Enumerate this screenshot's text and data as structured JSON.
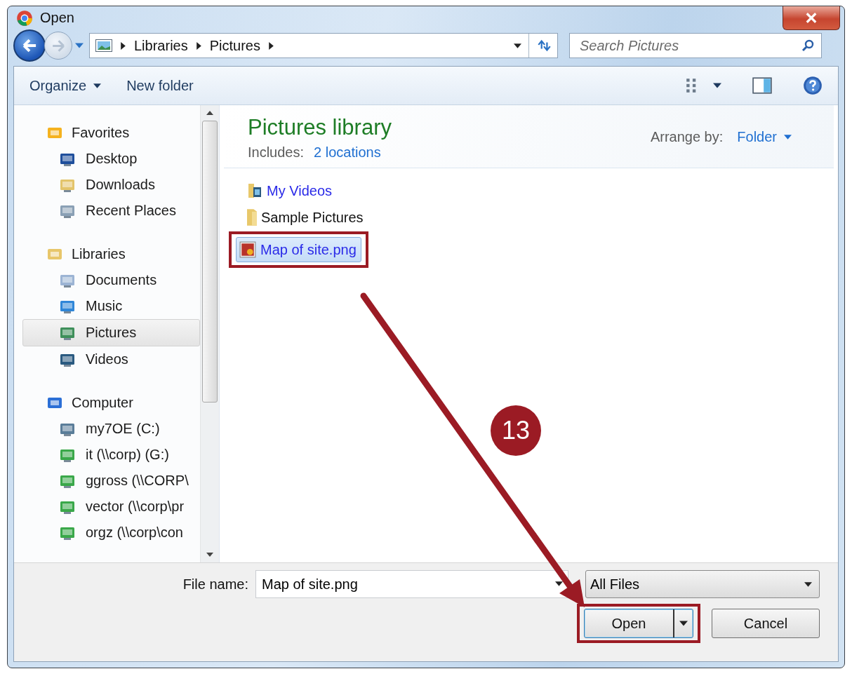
{
  "window": {
    "title": "Open"
  },
  "address": {
    "crumbs": [
      "Libraries",
      "Pictures"
    ],
    "search_placeholder": "Search Pictures"
  },
  "toolbar": {
    "organize": "Organize",
    "new_folder": "New folder"
  },
  "sidebar": {
    "groups": [
      {
        "label": "Favorites",
        "kind": "favorites",
        "items": [
          {
            "label": "Desktop",
            "kind": "desktop",
            "selected": false
          },
          {
            "label": "Downloads",
            "kind": "downloads",
            "selected": false
          },
          {
            "label": "Recent Places",
            "kind": "recent",
            "selected": false
          }
        ]
      },
      {
        "label": "Libraries",
        "kind": "libraries",
        "items": [
          {
            "label": "Documents",
            "kind": "documents",
            "selected": false
          },
          {
            "label": "Music",
            "kind": "music",
            "selected": false
          },
          {
            "label": "Pictures",
            "kind": "pictures",
            "selected": true
          },
          {
            "label": "Videos",
            "kind": "videos",
            "selected": false
          }
        ]
      },
      {
        "label": "Computer",
        "kind": "computer",
        "items": [
          {
            "label": "my7OE (C:)",
            "kind": "drive",
            "selected": false
          },
          {
            "label": "it (\\\\corp) (G:)",
            "kind": "network",
            "selected": false
          },
          {
            "label": "ggross (\\\\CORP\\",
            "kind": "network",
            "selected": false
          },
          {
            "label": "vector (\\\\corp\\pr",
            "kind": "network",
            "selected": false
          },
          {
            "label": "orgz (\\\\corp\\con",
            "kind": "network",
            "selected": false
          }
        ]
      }
    ]
  },
  "library": {
    "title": "Pictures library",
    "includes_label": "Includes:",
    "includes_link": "2 locations",
    "arrange_label": "Arrange by:",
    "arrange_value": "Folder"
  },
  "files": [
    {
      "name": "My Videos",
      "kind": "video-folder",
      "selected": false,
      "highlighted": false
    },
    {
      "name": "Sample Pictures",
      "kind": "folder",
      "selected": false,
      "highlighted": false
    },
    {
      "name": "Map of site.png",
      "kind": "image",
      "selected": true,
      "highlighted": true
    }
  ],
  "footer": {
    "file_name_label": "File name:",
    "file_name": "Map of site.png",
    "file_type": "All Files",
    "open": "Open",
    "cancel": "Cancel",
    "open_highlighted": true
  },
  "annotation": {
    "step": "13"
  }
}
